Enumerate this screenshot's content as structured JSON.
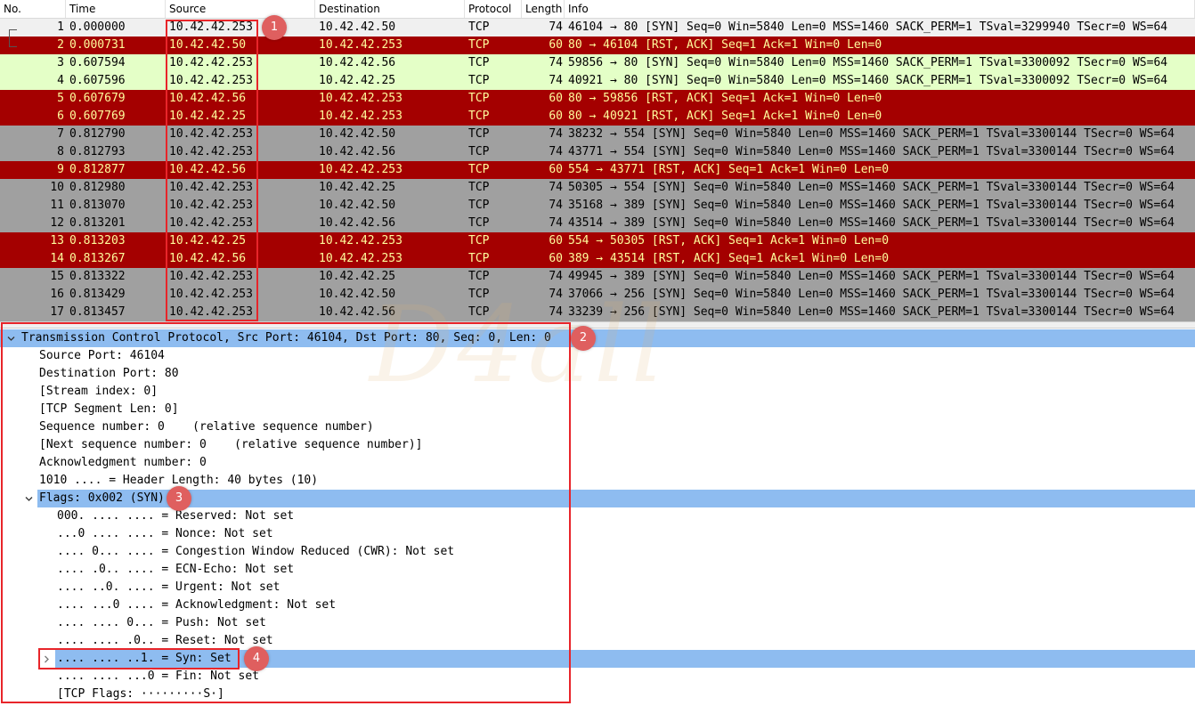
{
  "packet_list": {
    "columns": [
      {
        "key": "no",
        "label": "No."
      },
      {
        "key": "time",
        "label": "Time"
      },
      {
        "key": "source",
        "label": "Source"
      },
      {
        "key": "destination",
        "label": "Destination"
      },
      {
        "key": "protocol",
        "label": "Protocol"
      },
      {
        "key": "length",
        "label": "Length"
      },
      {
        "key": "info",
        "label": "Info"
      }
    ],
    "colors": {
      "selected_bg": "#f0f0f0",
      "selected_fg": "#000000",
      "syn_bg": "#e4ffc7",
      "syn_fg": "#000000",
      "rst_bg": "#a40000",
      "rst_fg": "#fffc9c",
      "gray_bg": "#a0a0a0",
      "gray_fg": "#000000"
    },
    "rows": [
      {
        "no": "1",
        "time": "0.000000",
        "source": "10.42.42.253",
        "destination": "10.42.42.50",
        "protocol": "TCP",
        "length": "74",
        "info": "46104 → 80 [SYN] Seq=0 Win=5840 Len=0 MSS=1460 SACK_PERM=1 TSval=3299940 TSecr=0 WS=64",
        "style": "selected"
      },
      {
        "no": "2",
        "time": "0.000731",
        "source": "10.42.42.50",
        "destination": "10.42.42.253",
        "protocol": "TCP",
        "length": "60",
        "info": "80 → 46104 [RST, ACK] Seq=1 Ack=1 Win=0 Len=0",
        "style": "rst"
      },
      {
        "no": "3",
        "time": "0.607594",
        "source": "10.42.42.253",
        "destination": "10.42.42.56",
        "protocol": "TCP",
        "length": "74",
        "info": "59856 → 80 [SYN] Seq=0 Win=5840 Len=0 MSS=1460 SACK_PERM=1 TSval=3300092 TSecr=0 WS=64",
        "style": "syn"
      },
      {
        "no": "4",
        "time": "0.607596",
        "source": "10.42.42.253",
        "destination": "10.42.42.25",
        "protocol": "TCP",
        "length": "74",
        "info": "40921 → 80 [SYN] Seq=0 Win=5840 Len=0 MSS=1460 SACK_PERM=1 TSval=3300092 TSecr=0 WS=64",
        "style": "syn"
      },
      {
        "no": "5",
        "time": "0.607679",
        "source": "10.42.42.56",
        "destination": "10.42.42.253",
        "protocol": "TCP",
        "length": "60",
        "info": "80 → 59856 [RST, ACK] Seq=1 Ack=1 Win=0 Len=0",
        "style": "rst"
      },
      {
        "no": "6",
        "time": "0.607769",
        "source": "10.42.42.25",
        "destination": "10.42.42.253",
        "protocol": "TCP",
        "length": "60",
        "info": "80 → 40921 [RST, ACK] Seq=1 Ack=1 Win=0 Len=0",
        "style": "rst"
      },
      {
        "no": "7",
        "time": "0.812790",
        "source": "10.42.42.253",
        "destination": "10.42.42.50",
        "protocol": "TCP",
        "length": "74",
        "info": "38232 → 554 [SYN] Seq=0 Win=5840 Len=0 MSS=1460 SACK_PERM=1 TSval=3300144 TSecr=0 WS=64",
        "style": "gray"
      },
      {
        "no": "8",
        "time": "0.812793",
        "source": "10.42.42.253",
        "destination": "10.42.42.56",
        "protocol": "TCP",
        "length": "74",
        "info": "43771 → 554 [SYN] Seq=0 Win=5840 Len=0 MSS=1460 SACK_PERM=1 TSval=3300144 TSecr=0 WS=64",
        "style": "gray"
      },
      {
        "no": "9",
        "time": "0.812877",
        "source": "10.42.42.56",
        "destination": "10.42.42.253",
        "protocol": "TCP",
        "length": "60",
        "info": "554 → 43771 [RST, ACK] Seq=1 Ack=1 Win=0 Len=0",
        "style": "rst"
      },
      {
        "no": "10",
        "time": "0.812980",
        "source": "10.42.42.253",
        "destination": "10.42.42.25",
        "protocol": "TCP",
        "length": "74",
        "info": "50305 → 554 [SYN] Seq=0 Win=5840 Len=0 MSS=1460 SACK_PERM=1 TSval=3300144 TSecr=0 WS=64",
        "style": "gray"
      },
      {
        "no": "11",
        "time": "0.813070",
        "source": "10.42.42.253",
        "destination": "10.42.42.50",
        "protocol": "TCP",
        "length": "74",
        "info": "35168 → 389 [SYN] Seq=0 Win=5840 Len=0 MSS=1460 SACK_PERM=1 TSval=3300144 TSecr=0 WS=64",
        "style": "gray"
      },
      {
        "no": "12",
        "time": "0.813201",
        "source": "10.42.42.253",
        "destination": "10.42.42.56",
        "protocol": "TCP",
        "length": "74",
        "info": "43514 → 389 [SYN] Seq=0 Win=5840 Len=0 MSS=1460 SACK_PERM=1 TSval=3300144 TSecr=0 WS=64",
        "style": "gray"
      },
      {
        "no": "13",
        "time": "0.813203",
        "source": "10.42.42.25",
        "destination": "10.42.42.253",
        "protocol": "TCP",
        "length": "60",
        "info": "554 → 50305 [RST, ACK] Seq=1 Ack=1 Win=0 Len=0",
        "style": "rst"
      },
      {
        "no": "14",
        "time": "0.813267",
        "source": "10.42.42.56",
        "destination": "10.42.42.253",
        "protocol": "TCP",
        "length": "60",
        "info": "389 → 43514 [RST, ACK] Seq=1 Ack=1 Win=0 Len=0",
        "style": "rst"
      },
      {
        "no": "15",
        "time": "0.813322",
        "source": "10.42.42.253",
        "destination": "10.42.42.25",
        "protocol": "TCP",
        "length": "74",
        "info": "49945 → 389 [SYN] Seq=0 Win=5840 Len=0 MSS=1460 SACK_PERM=1 TSval=3300144 TSecr=0 WS=64",
        "style": "gray"
      },
      {
        "no": "16",
        "time": "0.813429",
        "source": "10.42.42.253",
        "destination": "10.42.42.50",
        "protocol": "TCP",
        "length": "74",
        "info": "37066 → 256 [SYN] Seq=0 Win=5840 Len=0 MSS=1460 SACK_PERM=1 TSval=3300144 TSecr=0 WS=64",
        "style": "gray"
      },
      {
        "no": "17",
        "time": "0.813457",
        "source": "10.42.42.253",
        "destination": "10.42.42.56",
        "protocol": "TCP",
        "length": "74",
        "info": "33239 → 256 [SYN] Seq=0 Win=5840 Len=0 MSS=1460 SACK_PERM=1 TSval=3300144 TSecr=0 WS=64",
        "style": "gray"
      }
    ]
  },
  "details": {
    "selected_bg": "#8ebcf0",
    "rows": [
      {
        "name": "tcp-header-row",
        "text": "Transmission Control Protocol, Src Port: 46104, Dst Port: 80, Seq: 0, Len: 0",
        "level": 0,
        "toggle": "expanded",
        "selected": true
      },
      {
        "name": "source-port-row",
        "text": "Source Port: 46104",
        "level": 1
      },
      {
        "name": "destination-port-row",
        "text": "Destination Port: 80",
        "level": 1
      },
      {
        "name": "stream-index-row",
        "text": "[Stream index: 0]",
        "level": 1
      },
      {
        "name": "segment-len-row",
        "text": "[TCP Segment Len: 0]",
        "level": 1
      },
      {
        "name": "sequence-number-row",
        "text": "Sequence number: 0    (relative sequence number)",
        "level": 1
      },
      {
        "name": "next-sequence-row",
        "text": "[Next sequence number: 0    (relative sequence number)]",
        "level": 1
      },
      {
        "name": "ack-number-row",
        "text": "Acknowledgment number: 0",
        "level": 1
      },
      {
        "name": "header-length-row",
        "text": "1010 .... = Header Length: 40 bytes (10)",
        "level": 1
      },
      {
        "name": "flags-row",
        "text": "Flags: 0x002 (SYN)",
        "level": 1,
        "toggle": "expanded",
        "selected": true
      },
      {
        "name": "flag-reserved-row",
        "text": "000. .... .... = Reserved: Not set",
        "level": 2
      },
      {
        "name": "flag-nonce-row",
        "text": "...0 .... .... = Nonce: Not set",
        "level": 2
      },
      {
        "name": "flag-cwr-row",
        "text": ".... 0... .... = Congestion Window Reduced (CWR): Not set",
        "level": 2
      },
      {
        "name": "flag-ecn-row",
        "text": ".... .0.. .... = ECN-Echo: Not set",
        "level": 2
      },
      {
        "name": "flag-urgent-row",
        "text": ".... ..0. .... = Urgent: Not set",
        "level": 2
      },
      {
        "name": "flag-ack-row",
        "text": ".... ...0 .... = Acknowledgment: Not set",
        "level": 2
      },
      {
        "name": "flag-push-row",
        "text": ".... .... 0... = Push: Not set",
        "level": 2
      },
      {
        "name": "flag-reset-row",
        "text": ".... .... .0.. = Reset: Not set",
        "level": 2
      },
      {
        "name": "flag-syn-row",
        "text": ".... .... ..1. = Syn: Set",
        "level": 2,
        "toggle": "collapsed",
        "selected": true
      },
      {
        "name": "flag-fin-row",
        "text": ".... .... ...0 = Fin: Not set",
        "level": 2
      },
      {
        "name": "tcp-flags-row",
        "text": "[TCP Flags: ·········S·]",
        "level": 2
      }
    ]
  },
  "annotations": {
    "color": "#e8252a",
    "marker_color": "#df5f5f",
    "markers": [
      "1",
      "2",
      "3",
      "4"
    ]
  },
  "watermark": {
    "text": "D4all"
  }
}
